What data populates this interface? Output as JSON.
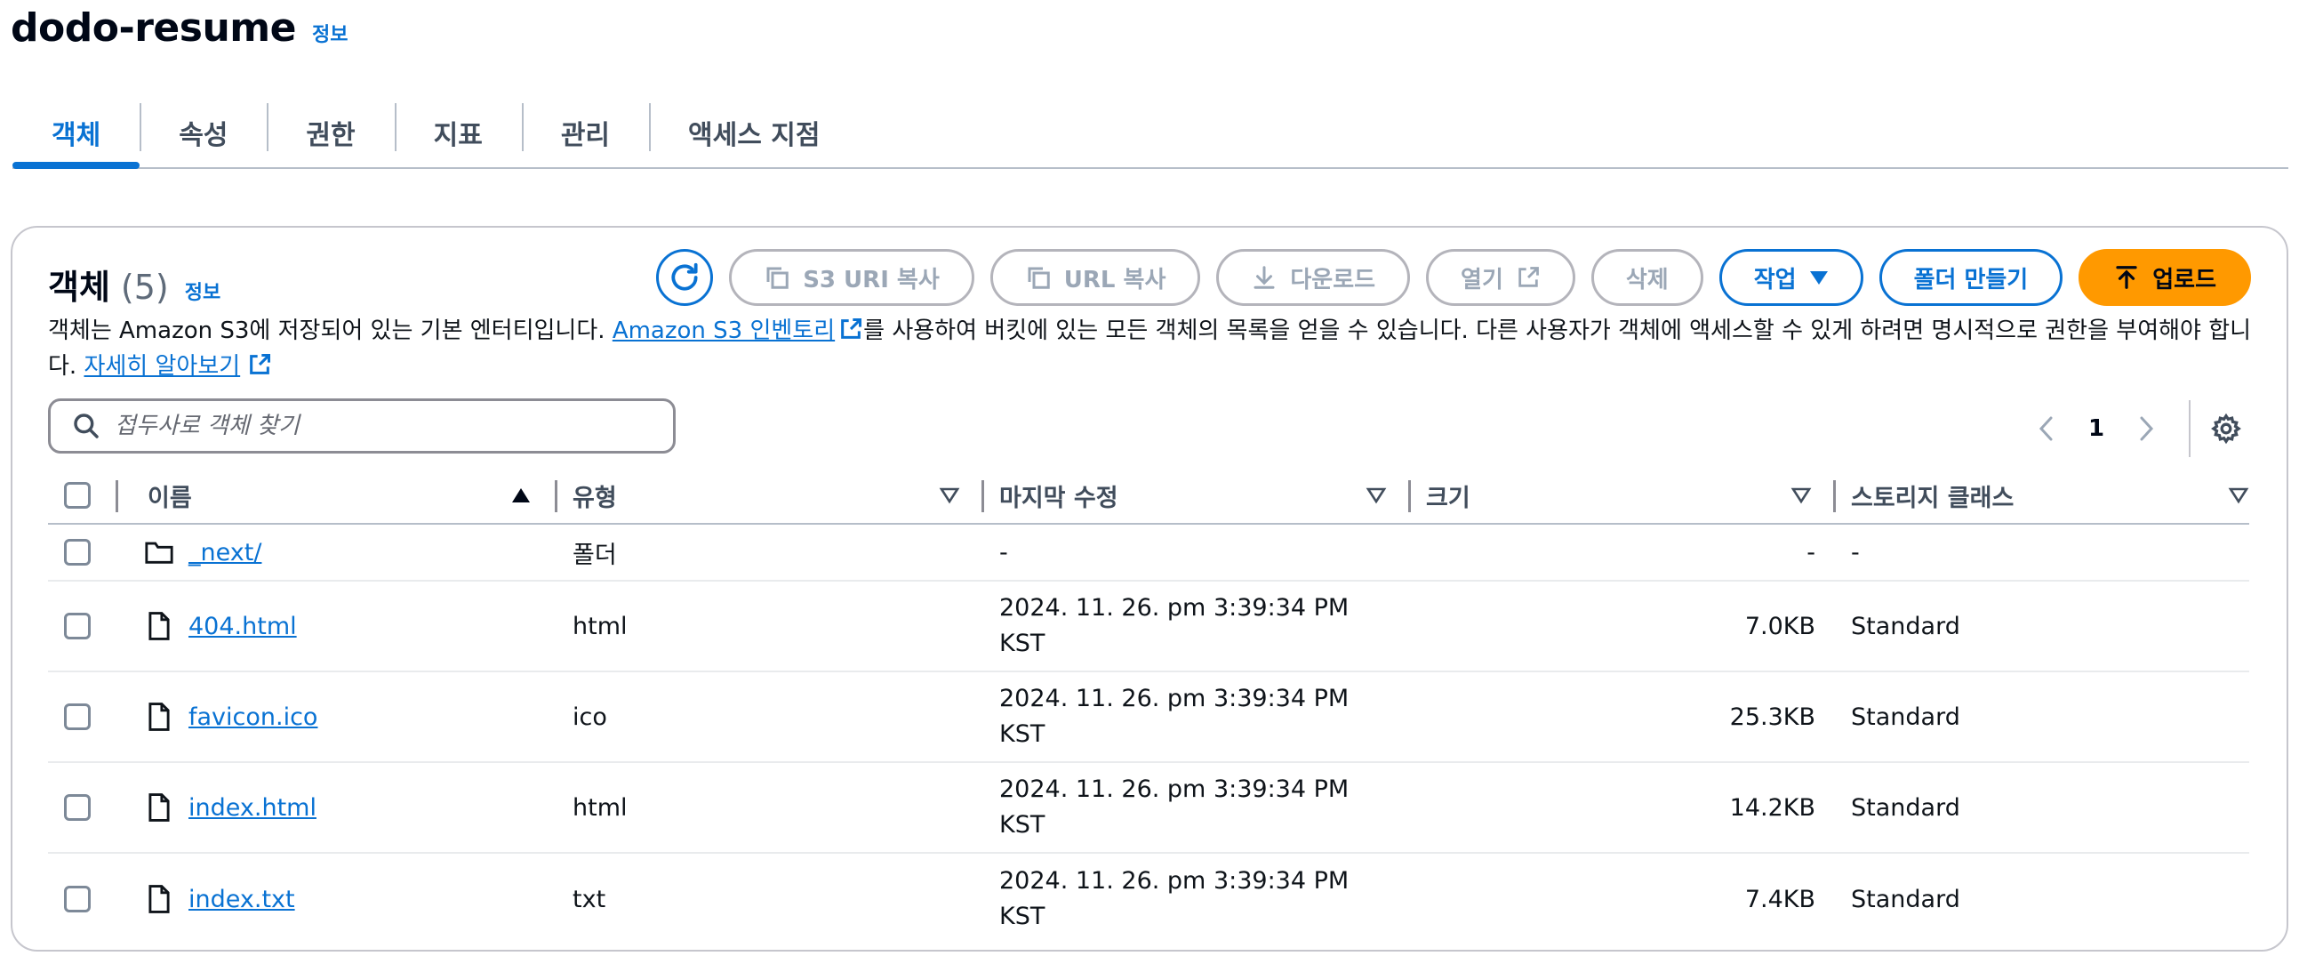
{
  "header": {
    "title": "dodo-resume",
    "info": "정보"
  },
  "tabs": [
    {
      "label": "객체",
      "active": true
    },
    {
      "label": "속성"
    },
    {
      "label": "권한"
    },
    {
      "label": "지표"
    },
    {
      "label": "관리"
    },
    {
      "label": "액세스 지점"
    }
  ],
  "objects": {
    "title": "객체",
    "count": "(5)",
    "info": "정보",
    "actions": {
      "copy_s3_uri": "S3 URI 복사",
      "copy_url": "URL 복사",
      "download": "다운로드",
      "open": "열기",
      "delete": "삭제",
      "actions": "작업",
      "create_folder": "폴더 만들기",
      "upload": "업로드"
    },
    "description": {
      "part1": "객체는 Amazon S3에 저장되어 있는 기본 엔터티입니다. ",
      "inventory_link": "Amazon S3 인벤토리",
      "part2": "를 사용하여 버킷에 있는 모든 객체의 목록을 얻을 수 있습니다. 다른 사용자가 객체에 액세스할 수 있게 하려면 명시적으로 권한을 부여해야 합니다. ",
      "learn_more": "자세히 알아보기"
    },
    "search": {
      "placeholder": "접두사로 객체 찾기"
    },
    "pagination": {
      "current_page": "1"
    },
    "columns": {
      "name": "이름",
      "type": "유형",
      "modified": "마지막 수정",
      "size": "크기",
      "storage_class": "스토리지 클래스"
    },
    "rows": [
      {
        "kind": "folder",
        "name": "_next/",
        "type": "폴더",
        "modified_1": "-",
        "modified_2": "",
        "size": "-",
        "storage_class": "-"
      },
      {
        "kind": "file",
        "name": "404.html",
        "type": "html",
        "modified_1": "2024. 11. 26. pm 3:39:34 PM",
        "modified_2": "KST",
        "size": "7.0KB",
        "storage_class": "Standard"
      },
      {
        "kind": "file",
        "name": "favicon.ico",
        "type": "ico",
        "modified_1": "2024. 11. 26. pm 3:39:34 PM",
        "modified_2": "KST",
        "size": "25.3KB",
        "storage_class": "Standard"
      },
      {
        "kind": "file",
        "name": "index.html",
        "type": "html",
        "modified_1": "2024. 11. 26. pm 3:39:34 PM",
        "modified_2": "KST",
        "size": "14.2KB",
        "storage_class": "Standard"
      },
      {
        "kind": "file",
        "name": "index.txt",
        "type": "txt",
        "modified_1": "2024. 11. 26. pm 3:39:34 PM",
        "modified_2": "KST",
        "size": "7.4KB",
        "storage_class": "Standard"
      }
    ]
  },
  "colors": {
    "link": "#0972d3",
    "primary_button": "#ff9900",
    "disabled": "#9ba7b6"
  }
}
